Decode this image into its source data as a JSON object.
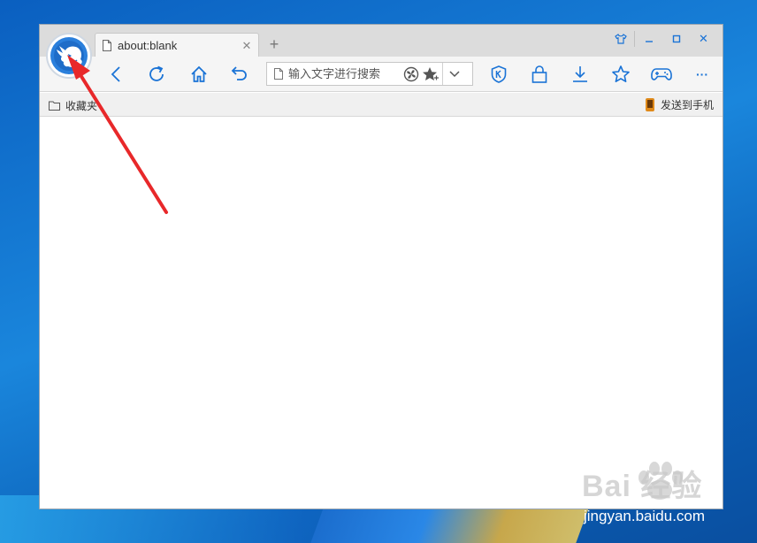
{
  "tabs": [
    {
      "title": "about:blank",
      "close_glyph": "✕"
    }
  ],
  "new_tab_glyph": "+",
  "window_controls": {
    "skin_icon": "shirt-icon",
    "minimize_icon": "minimize-icon",
    "maximize_icon": "maximize-icon",
    "close_glyph": "✕"
  },
  "toolbar": {
    "back_icon": "back-icon",
    "refresh_icon": "refresh-icon",
    "home_icon": "home-icon",
    "undo_icon": "undo-icon",
    "more_glyph": "···"
  },
  "address_bar": {
    "value": "",
    "placeholder": "输入文字进行搜索"
  },
  "favorites_bar": {
    "folder_label": "收藏夹",
    "send_to_phone_label": "发送到手机"
  },
  "watermark": {
    "brand": "Bai 经验",
    "site": "jingyan.baidu.com"
  },
  "colors": {
    "accent": "#1a73d6",
    "annotation": "#e8282a"
  }
}
